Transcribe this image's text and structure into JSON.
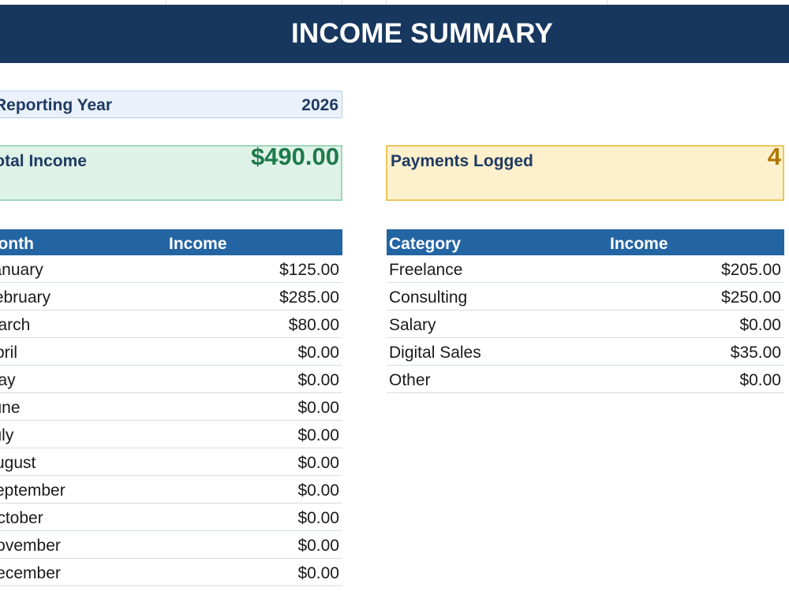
{
  "title": "INCOME SUMMARY",
  "reporting_year": {
    "label": "Reporting Year",
    "value": "2026"
  },
  "total_income": {
    "label": "Total Income",
    "value": "$490.00",
    "color": "#1d7a4b"
  },
  "payments_logged": {
    "label": "Payments Logged",
    "value": "4",
    "color": "#b27800"
  },
  "month_table": {
    "headers": [
      "Month",
      "Income"
    ],
    "rows": [
      {
        "month": "January",
        "income": "$125.00"
      },
      {
        "month": "February",
        "income": "$285.00"
      },
      {
        "month": "March",
        "income": "$80.00"
      },
      {
        "month": "April",
        "income": "$0.00"
      },
      {
        "month": "May",
        "income": "$0.00"
      },
      {
        "month": "June",
        "income": "$0.00"
      },
      {
        "month": "July",
        "income": "$0.00"
      },
      {
        "month": "August",
        "income": "$0.00"
      },
      {
        "month": "September",
        "income": "$0.00"
      },
      {
        "month": "October",
        "income": "$0.00"
      },
      {
        "month": "November",
        "income": "$0.00"
      },
      {
        "month": "December",
        "income": "$0.00"
      }
    ]
  },
  "category_table": {
    "headers": [
      "Category",
      "Income"
    ],
    "rows": [
      {
        "category": "Freelance",
        "income": "$205.00"
      },
      {
        "category": "Consulting",
        "income": "$250.00"
      },
      {
        "category": "Salary",
        "income": "$0.00"
      },
      {
        "category": "Digital Sales",
        "income": "$35.00"
      },
      {
        "category": "Other",
        "income": "$0.00"
      }
    ]
  },
  "colors": {
    "title_bar": "#17375e",
    "table_header": "#2364a3",
    "year_box": "#eaf1fa",
    "total_card": "#dff2e8",
    "payments_card": "#fdf0cc"
  }
}
